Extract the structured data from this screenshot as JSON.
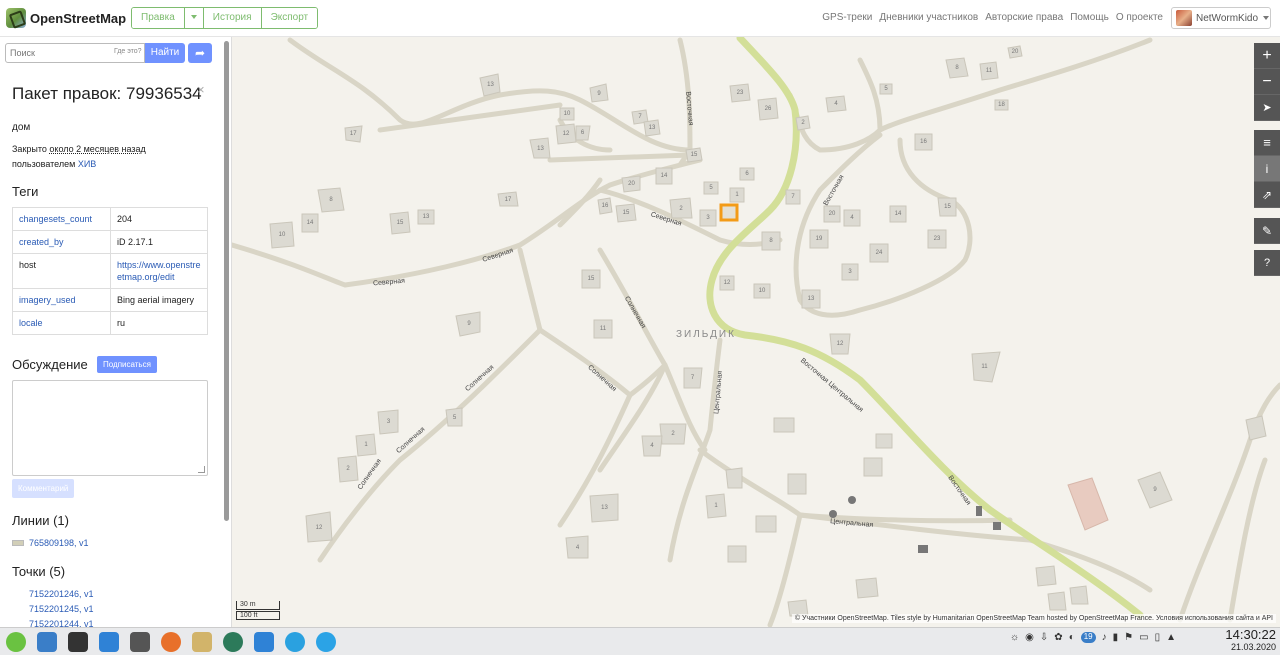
{
  "header": {
    "logo_text": "OpenStreetMap",
    "tabs": [
      {
        "label": "Правка"
      },
      {
        "label": ""
      },
      {
        "label": "История"
      },
      {
        "label": "Экспорт"
      }
    ],
    "nav": [
      "GPS-треки",
      "Дневники участников",
      "Авторские права",
      "Помощь",
      "О проекте"
    ],
    "user": "NetWormKido"
  },
  "sidebar": {
    "search_placeholder": "Поиск",
    "where_is": "Где это?",
    "search_button": "Найти",
    "changeset_title": "Пакет правок: 79936534",
    "close_glyph": "×",
    "comment": "дом",
    "closed_prefix": "Закрыто",
    "closed_ago": "около 2 месяцев назад",
    "closed_by": "пользователем",
    "closed_user": "ХИВ",
    "tags_heading": "Теги",
    "tags": [
      {
        "key": "changesets_count",
        "value": "204"
      },
      {
        "key": "created_by",
        "value": "iD 2.17.1"
      },
      {
        "key": "host",
        "value": "https://www.openstreetmap.org/edit"
      },
      {
        "key": "imagery_used",
        "value": "Bing aerial imagery"
      },
      {
        "key": "locale",
        "value": "ru"
      }
    ],
    "discussion_heading": "Обсуждение",
    "subscribe_button": "Подписаться",
    "comment_button": "Комментарий",
    "ways_heading": "Линии (1)",
    "ways": [
      "765809198, v1"
    ],
    "nodes_heading": "Точки (5)",
    "nodes": [
      "7152201246, v1",
      "7152201245, v1",
      "7152201244, v1"
    ]
  },
  "map": {
    "village_label": "ЗИЛЬДИК",
    "street_labels": [
      "Северная",
      "Северная",
      "Северная",
      "Солнечная",
      "Солнечная",
      "Солнечная",
      "Солнечная",
      "Солнечная",
      "Центральная",
      "Центральная",
      "Восточная",
      "Восточная",
      "Восточная",
      "Восточная Центральная"
    ],
    "house_numbers": [
      "13",
      "9",
      "17",
      "13",
      "12",
      "10",
      "6",
      "7",
      "13",
      "15",
      "23",
      "26",
      "2",
      "4",
      "5",
      "8",
      "11",
      "20",
      "18",
      "16",
      "15",
      "14",
      "23",
      "24",
      "3",
      "20",
      "4",
      "19",
      "13",
      "12",
      "11",
      "9",
      "8",
      "10",
      "14",
      "15",
      "13",
      "17",
      "16",
      "15",
      "20",
      "14",
      "2",
      "3",
      "5",
      "1",
      "6",
      "8",
      "7",
      "10",
      "12",
      "15",
      "11",
      "9",
      "7",
      "2",
      "4",
      "5",
      "3",
      "1",
      "2",
      "12",
      "4",
      "13",
      "1"
    ],
    "controls": [
      "+",
      "−",
      "➤",
      "≡",
      "i",
      "⇗",
      "✎",
      "?"
    ],
    "scale_m": "30 m",
    "scale_ft": "100 ft",
    "attribution": "© Участники OpenStreetMap. Tiles style by Humanitarian OpenStreetMap Team hosted by OpenStreetMap France. Условия использования сайта и API"
  },
  "taskbar": {
    "clock_time": "14:30:22",
    "clock_date": "21.03.2020",
    "tray_badge": "19"
  },
  "colors": {
    "accent": "#7092ff",
    "edit_green": "#7ebc6f",
    "road_main": "#d3df98",
    "changeset_box": "#f39b17"
  }
}
